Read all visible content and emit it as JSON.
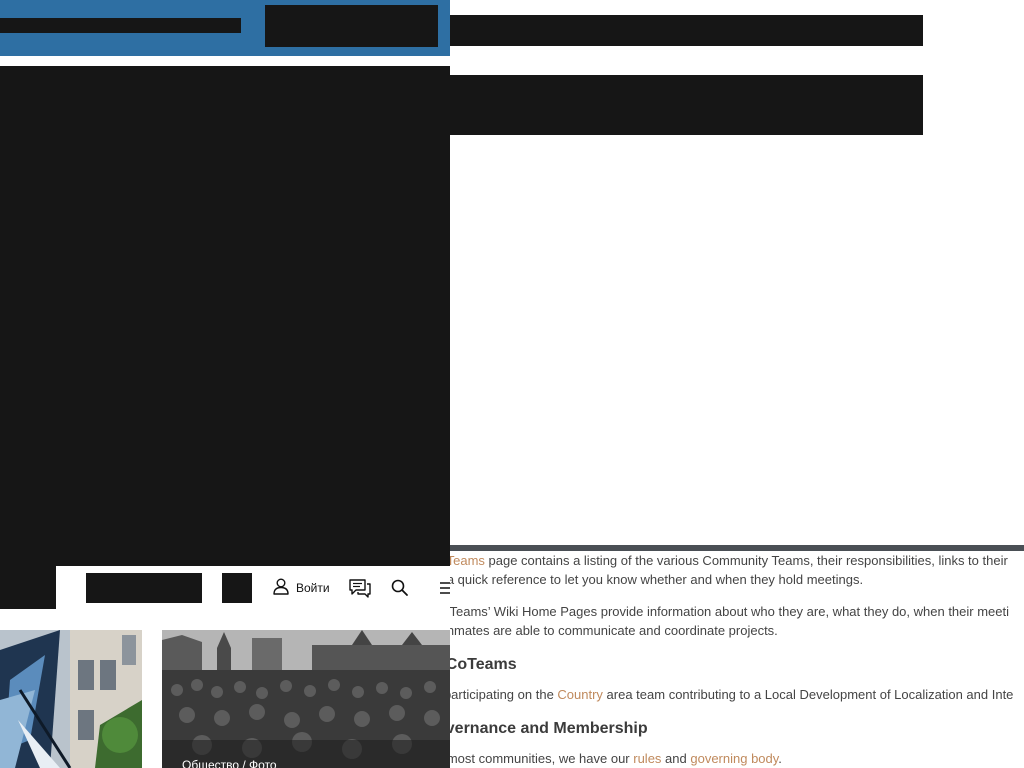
{
  "toolbar": {
    "login_label": "Войти",
    "icons": {
      "user": "user-icon",
      "chat": "chat-icon",
      "search": "search-icon",
      "menu": "menu-icon"
    }
  },
  "photos": {
    "second_caption": "Общество / Фото"
  },
  "content": {
    "p1_line1_pre": "e ",
    "p1_link_teams": "Teams",
    "p1_line1_post": " page contains a listing of the various Community Teams, their responsibilities, links to their",
    "p1_line2": "d a quick reference to let you know whether and when they hold meetings.",
    "p2_line1": "st Teams’ Wiki Home Pages provide information about who they are, what they do, when their meeti",
    "p2_line2": "ammates are able to communicate and coordinate projects.",
    "heading_locoteams": "oCoTeams",
    "p3_pre": "r participating on the ",
    "p3_link_country": "Country",
    "p3_post": " area team contributing to a Local Development of Localization and Inte",
    "heading_governance": "overnance and Membership",
    "p4_pre": "e most communities, we have our ",
    "p4_link_rules": "rules",
    "p4_mid": " and ",
    "p4_link_governing": "governing body",
    "p4_post": "."
  },
  "colors": {
    "header_blue": "#2e6fa3",
    "redaction": "#161616",
    "link": "#c08a5d",
    "rule": "#4a4f55"
  }
}
